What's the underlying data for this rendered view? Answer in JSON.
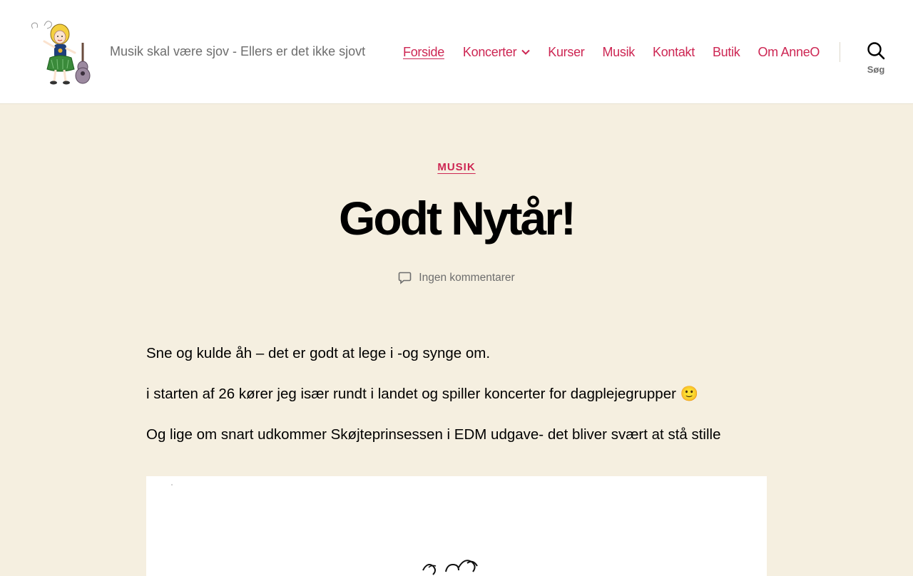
{
  "site": {
    "tagline": "Musik skal være sjov - Ellers er det ikke sjovt"
  },
  "nav": {
    "items": [
      {
        "label": "Forside",
        "active": true
      },
      {
        "label": "Koncerter",
        "has_submenu": true
      },
      {
        "label": "Kurser"
      },
      {
        "label": "Musik"
      },
      {
        "label": "Kontakt"
      },
      {
        "label": "Butik"
      },
      {
        "label": "Om AnneO"
      }
    ]
  },
  "search": {
    "label": "Søg",
    "icon": "search-icon"
  },
  "post": {
    "category": "MUSIK",
    "title": "Godt Nytår!",
    "comments": "Ingen kommentarer",
    "paragraphs": [
      "Sne og kulde åh – det er godt at lege i -og synge om.",
      "i starten af 26 kører jeg især rundt i landet og spiller koncerter for dagplejegrupper 🙂",
      "Og lige om snart udkommer Skøjteprinsessen i EDM udgave- det bliver svært at stå stille"
    ]
  },
  "colors": {
    "accent": "#cd2653",
    "background": "#f5efe0",
    "header_bg": "#ffffff",
    "secondary_text": "#6d6d6d"
  }
}
